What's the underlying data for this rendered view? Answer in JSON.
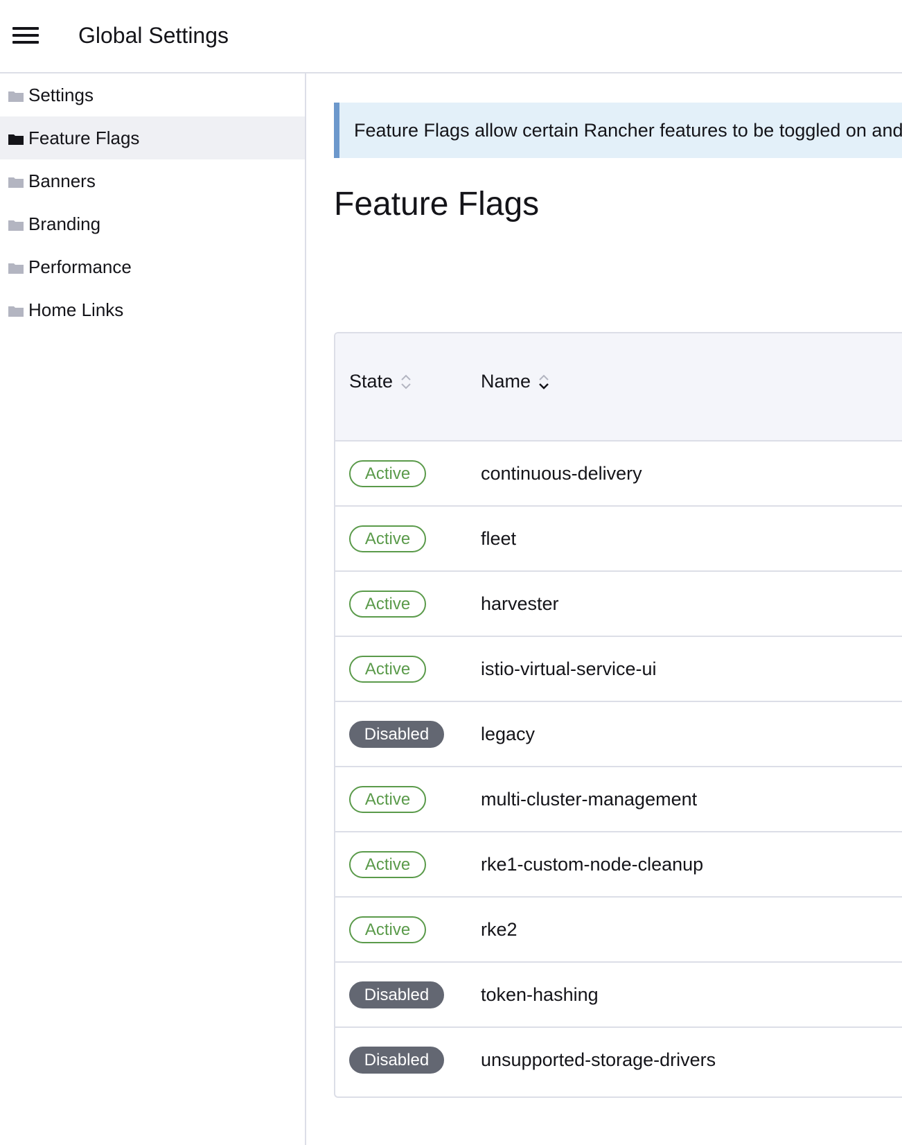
{
  "header": {
    "title": "Global Settings",
    "menu_icon": "hamburger-menu-icon"
  },
  "sidebar": {
    "items": [
      {
        "label": "Settings",
        "icon": "folder-icon",
        "active": false
      },
      {
        "label": "Feature Flags",
        "icon": "folder-icon",
        "active": true
      },
      {
        "label": "Banners",
        "icon": "folder-icon",
        "active": false
      },
      {
        "label": "Branding",
        "icon": "folder-icon",
        "active": false
      },
      {
        "label": "Performance",
        "icon": "folder-icon",
        "active": false
      },
      {
        "label": "Home Links",
        "icon": "folder-icon",
        "active": false
      }
    ]
  },
  "main": {
    "banner_text": "Feature Flags allow certain Rancher features to be toggled on and",
    "title": "Feature Flags",
    "table": {
      "columns": [
        {
          "label": "State",
          "sort_icon": "sort-icon"
        },
        {
          "label": "Name",
          "sort_icon": "sort-desc-icon"
        }
      ],
      "rows": [
        {
          "state": "Active",
          "name": "continuous-delivery"
        },
        {
          "state": "Active",
          "name": "fleet"
        },
        {
          "state": "Active",
          "name": "harvester"
        },
        {
          "state": "Active",
          "name": "istio-virtual-service-ui"
        },
        {
          "state": "Disabled",
          "name": "legacy"
        },
        {
          "state": "Active",
          "name": "multi-cluster-management"
        },
        {
          "state": "Active",
          "name": "rke1-custom-node-cleanup"
        },
        {
          "state": "Active",
          "name": "rke2"
        },
        {
          "state": "Disabled",
          "name": "token-hashing"
        },
        {
          "state": "Disabled",
          "name": "unsupported-storage-drivers"
        }
      ]
    }
  },
  "colors": {
    "active_badge": "#5a9a4a",
    "disabled_badge": "#636772",
    "banner_bg": "#e3f0f9",
    "banner_accent": "#6c98cc",
    "sidebar_active_bg": "#eff0f4"
  }
}
